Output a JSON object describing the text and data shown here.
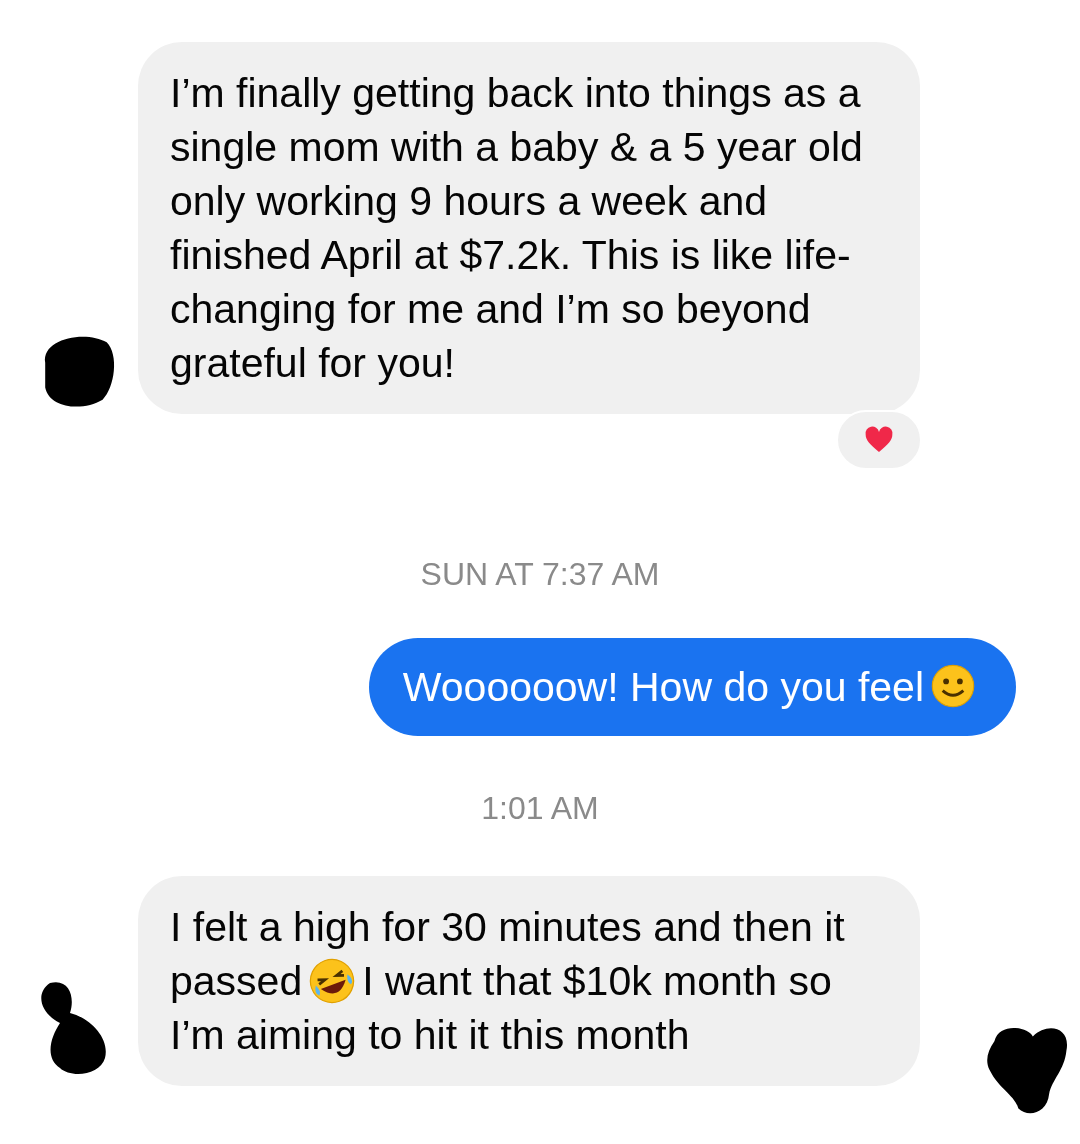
{
  "thread": [
    {
      "kind": "received",
      "parts": [
        {
          "kind": "text",
          "text": "I’m finally getting back into things as a single mom with a baby & a 5 year old only working 9 hours a week and finished April at $7.2k. This is like life-changing for me and I’m so beyond grateful for you!"
        }
      ],
      "reacted": true,
      "avatar_hidden": true
    },
    {
      "kind": "time",
      "text": "SUN AT 7:37 AM"
    },
    {
      "kind": "sent",
      "parts": [
        {
          "kind": "text",
          "text": "Woooooow! How do you feel"
        },
        {
          "kind": "smile"
        }
      ]
    },
    {
      "kind": "time",
      "text": "1:01 AM"
    },
    {
      "kind": "received",
      "parts": [
        {
          "kind": "text",
          "text": "I felt a high for 30 minutes and then it passed"
        },
        {
          "kind": "laugh"
        },
        {
          "kind": "text",
          "text": "I want that $10k month so I’m aiming to hit it this month"
        }
      ],
      "reacted": false,
      "avatar_hidden": true
    }
  ],
  "seen_marker_hidden": true
}
